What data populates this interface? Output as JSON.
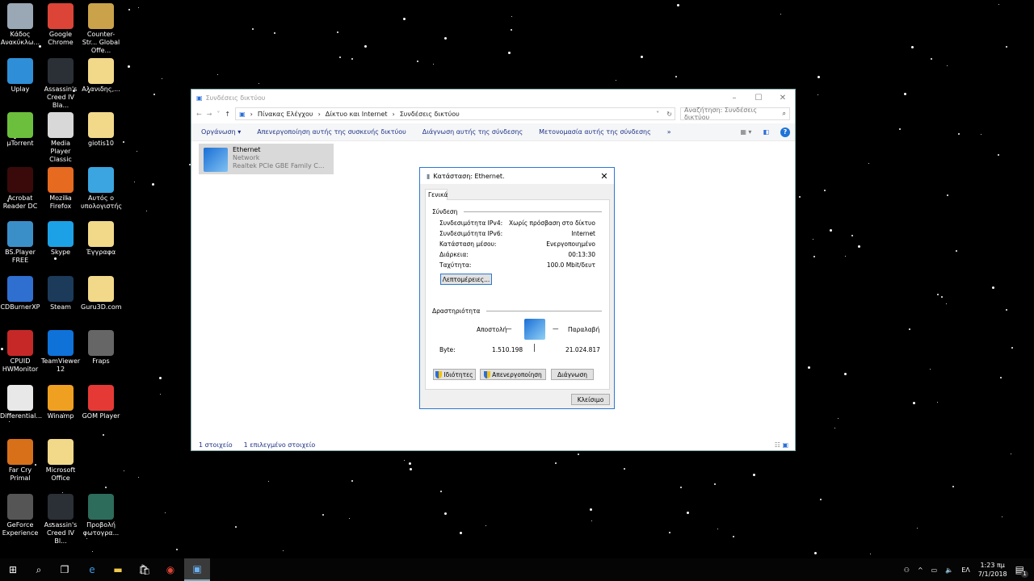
{
  "desktop_icons": [
    {
      "label": "Κάδος Ανακύκλω...",
      "color": "#9aa7b5"
    },
    {
      "label": "Google Chrome",
      "color": "#db4437"
    },
    {
      "label": "Counter-Str... Global Offe...",
      "color": "#c9a24a"
    },
    {
      "label": "Uplay",
      "color": "#2e8fd8"
    },
    {
      "label": "Assassin's Creed IV Bla...",
      "color": "#2b3036"
    },
    {
      "label": "Αλανιδης,...",
      "color": "#f2d98a"
    },
    {
      "label": "µTorrent",
      "color": "#6cbf3c"
    },
    {
      "label": "Media Player Classic",
      "color": "#d8d8d8"
    },
    {
      "label": "giotis10",
      "color": "#f2d98a"
    },
    {
      "label": "Acrobat Reader DC",
      "color": "#3a0a0a"
    },
    {
      "label": "Mozilla Firefox",
      "color": "#e66a1f"
    },
    {
      "label": "Αυτός ο υπολογιστής",
      "color": "#3aa5e0"
    },
    {
      "label": "BS.Player FREE",
      "color": "#3b8fc9"
    },
    {
      "label": "Skype",
      "color": "#1da1e6"
    },
    {
      "label": "Έγγραφα",
      "color": "#f2d98a"
    },
    {
      "label": "CDBurnerXP",
      "color": "#2f6fd0"
    },
    {
      "label": "Steam",
      "color": "#1c3a5a"
    },
    {
      "label": "Guru3D.com",
      "color": "#f2d98a"
    },
    {
      "label": "CPUID HWMonitor",
      "color": "#c62828"
    },
    {
      "label": "TeamViewer 12",
      "color": "#0e72d9"
    },
    {
      "label": "Fraps",
      "color": "#666"
    },
    {
      "label": "Differential...",
      "color": "#e8e8e8"
    },
    {
      "label": "Winamp",
      "color": "#f0a020"
    },
    {
      "label": "GOM Player",
      "color": "#e53935"
    },
    {
      "label": "Far Cry Primal",
      "color": "#d8701a"
    },
    {
      "label": "Microsoft Office",
      "color": "#f2d98a"
    },
    {
      "label": "GeForce Experience",
      "color": "#555"
    },
    {
      "label": "Assassin's Creed IV Bl...",
      "color": "#2b3036"
    },
    {
      "label": "Προβολή φωτογρα...",
      "color": "#2d6b5a"
    }
  ],
  "explorer": {
    "title": "Συνδέσεις δικτύου",
    "nav": {
      "back": "←",
      "forward": "→",
      "recent": "˅",
      "up": "↑"
    },
    "breadcrumb": [
      "Πίνακας Ελέγχου",
      "Δίκτυο και Internet",
      "Συνδέσεις δικτύου"
    ],
    "search_placeholder": "Αναζήτηση: Συνδέσεις δικτύου",
    "commands": [
      "Οργάνωση ▾",
      "Απενεργοποίηση αυτής της συσκευής δικτύου",
      "Διάγνωση αυτής της σύνδεσης",
      "Μετονομασία αυτής της σύνδεσης",
      "»"
    ],
    "item": {
      "name": "Ethernet",
      "network": "Network",
      "adapter": "Realtek PCIe GBE Family C..."
    },
    "status": {
      "count": "1 στοιχείο",
      "selected": "1 επιλεγμένο στοιχείο"
    }
  },
  "dialog": {
    "title": "Κατάσταση: Ethernet.",
    "tab": "Γενικά",
    "connection_header": "Σύνδεση",
    "rows": [
      {
        "label": "Συνδεσιμότητα IPv4:",
        "value": "Χωρίς πρόσβαση στο δίκτυο"
      },
      {
        "label": "Συνδεσιμότητα IPv6:",
        "value": "Internet"
      },
      {
        "label": "Κατάσταση μέσου:",
        "value": "Ενεργοποιημένο"
      },
      {
        "label": "Διάρκεια:",
        "value": "00:13:30"
      },
      {
        "label": "Ταχύτητα:",
        "value": "100.0 Mbit/δευτ"
      }
    ],
    "details_button": "Λεπτομέρειες...",
    "activity_header": "Δραστηριότητα",
    "sent_label": "Αποστολή",
    "received_label": "Παραλαβή",
    "bytes_label": "Byte:",
    "bytes_sent": "1.510.198",
    "bytes_received": "21.024.817",
    "properties_button": "Ιδιότητες",
    "disable_button": "Απενεργοποίηση",
    "diagnose_button": "Διάγνωση",
    "close_button": "Κλείσιμο"
  },
  "taskbar": {
    "time": "1:23 πμ",
    "date": "7/1/2018",
    "language": "ΕΛ",
    "notifications": "1"
  }
}
